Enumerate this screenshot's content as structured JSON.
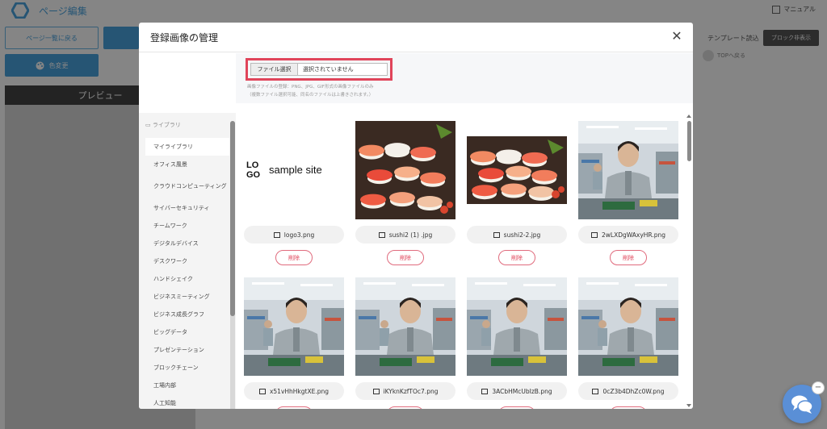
{
  "app": {
    "title": "ページ編集",
    "manual_label": "マニュアル",
    "back_label": "ページ一覧に戻る",
    "color_label": "色変更",
    "preview_label": "プレビュー",
    "template_label": "テンプレート読込",
    "block_label": "ブロック非表示",
    "top_label": "TOPへ戻る",
    "accent_color": "#4aa3df"
  },
  "modal": {
    "title": "登録画像の管理",
    "close_icon": "close-icon",
    "upload": {
      "button_label": "ファイル選択",
      "status_text": "選択されていません",
      "note_line1": "画像ファイルの登録：PNG、JPG、GIF形式の画像ファイルのみ",
      "note_line2": "（複数ファイル選択可能、同名のファイルは上書きされます。）",
      "highlight_color": "#e0445a"
    },
    "library": {
      "heading": "ライブラリ",
      "items": [
        "マイライブラリ",
        "オフィス風景",
        "クラウドコンピューティング",
        "サイバーセキュリティ",
        "チームワーク",
        "デジタルデバイス",
        "デスクワーク",
        "ハンドシェイク",
        "ビジネスミーティング",
        "ビジネス成長グラフ",
        "ビッグデータ",
        "プレゼンテーション",
        "ブロックチェーン",
        "工場内部",
        "人工知能"
      ],
      "active_index": 0
    },
    "images": [
      {
        "filename": "logo3.png",
        "delete_label": "削除",
        "kind": "logo",
        "logo_text": "sample site",
        "logo_mark": [
          "LO",
          "GO"
        ]
      },
      {
        "filename": "sushi2 (1) .jpg",
        "delete_label": "削除",
        "kind": "sushi"
      },
      {
        "filename": "sushi2-2.jpg",
        "delete_label": "削除",
        "kind": "sushi-wide"
      },
      {
        "filename": "2wLXDgWAxyHR.png",
        "delete_label": "削除",
        "kind": "worker"
      },
      {
        "filename": "x51vHhHkgtXE.png",
        "delete_label": "削除",
        "kind": "worker"
      },
      {
        "filename": "iKYknKzfTOc7.png",
        "delete_label": "削除",
        "kind": "worker"
      },
      {
        "filename": "3ACbHMcUbIzB.png",
        "delete_label": "削除",
        "kind": "worker"
      },
      {
        "filename": "0cZ3b4DhZc0W.png",
        "delete_label": "削除",
        "kind": "worker"
      }
    ]
  },
  "chat": {
    "icon": "chat-icon",
    "badge": "−"
  }
}
